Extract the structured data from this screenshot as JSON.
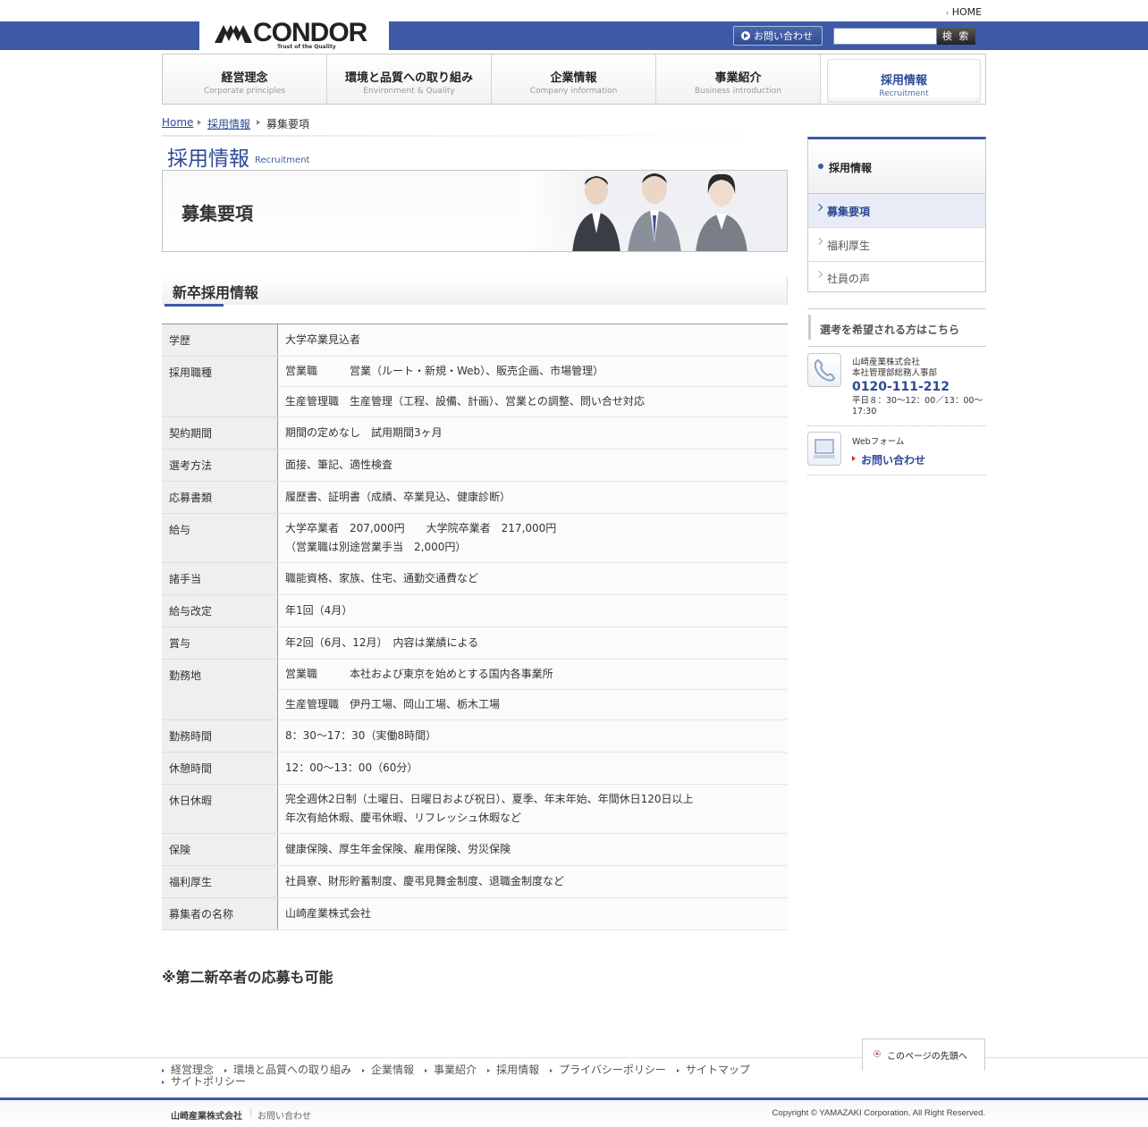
{
  "header": {
    "home_link": "HOME",
    "logo_text": "CONDOR",
    "logo_tagline": "Trust of the Quality",
    "contact_button": "お問い合わせ",
    "search_placeholder": "",
    "search_button": "検 索",
    "brand_color": "#3d5aa6"
  },
  "nav": {
    "items": [
      {
        "jp": "経営理念",
        "en": "Corporate principles"
      },
      {
        "jp": "環境と品質への取り組み",
        "en": "Environment & Quality"
      },
      {
        "jp": "企業情報",
        "en": "Company information"
      },
      {
        "jp": "事業紹介",
        "en": "Business introduction"
      },
      {
        "jp": "採用情報",
        "en": "Recruitment"
      }
    ],
    "active_index": 4
  },
  "breadcrumb": [
    "Home",
    "採用情報",
    "募集要項"
  ],
  "page": {
    "title": "採用情報",
    "title_en": "Recruitment",
    "banner_title": "募集要項",
    "section_title": "新卒採用情報",
    "note": "※第二新卒者の応募も可能"
  },
  "table": [
    {
      "label": "学歴",
      "lines": [
        "大学卒業見込者"
      ]
    },
    {
      "label": "採用職種",
      "lines": [
        "営業職　　　営業（ルート・新規・Web）、販売企画、市場管理）",
        "生産管理職　生産管理（工程、設備、計画）、営業との調整、問い合せ対応"
      ]
    },
    {
      "label": "契約期間",
      "lines": [
        "期間の定めなし　試用期間3ヶ月"
      ]
    },
    {
      "label": "選考方法",
      "lines": [
        "面接、筆記、適性検査"
      ]
    },
    {
      "label": "応募書類",
      "lines": [
        "履歴書、証明書（成績、卒業見込、健康診断）"
      ]
    },
    {
      "label": "給与",
      "lines": [
        "大学卒業者　207,000円　　大学院卒業者　217,000円",
        "（営業職は別途営業手当　2,000円）"
      ]
    },
    {
      "label": "諸手当",
      "lines": [
        "職能資格、家族、住宅、通勤交通費など"
      ]
    },
    {
      "label": "給与改定",
      "lines": [
        "年1回（4月）"
      ]
    },
    {
      "label": "賞与",
      "lines": [
        "年2回（6月、12月）　内容は業績による"
      ]
    },
    {
      "label": "勤務地",
      "lines": [
        "営業職　　　本社および東京を始めとする国内各事業所",
        "生産管理職　伊丹工場、岡山工場、栃木工場"
      ]
    },
    {
      "label": "勤務時間",
      "lines": [
        "8：30～17：30（実働8時間）"
      ]
    },
    {
      "label": "休憩時間",
      "lines": [
        "12：00～13：00（60分）"
      ]
    },
    {
      "label": "休日休暇",
      "lines": [
        "完全週休2日制（土曜日、日曜日および祝日）、夏季、年末年始、年間休日120日以上",
        "年次有給休暇、慶弔休暇、リフレッシュ休暇など"
      ]
    },
    {
      "label": "保険",
      "lines": [
        "健康保険、厚生年金保険、雇用保険、労災保険"
      ]
    },
    {
      "label": "福利厚生",
      "lines": [
        "社員寮、財形貯蓄制度、慶弔見舞金制度、退職金制度など"
      ]
    },
    {
      "label": "募集者の名称",
      "lines": [
        "山崎産業株式会社"
      ]
    }
  ],
  "sidebar": {
    "heading": "採用情報",
    "items": [
      "募集要項",
      "福利厚生",
      "社員の声"
    ],
    "active_index": 0,
    "apply_heading": "選考を希望される方はこちら",
    "phone_company": "山崎産業株式会社",
    "phone_dept": "本社管理部総務人事部",
    "phone_number": "0120-111-212",
    "phone_hours": "平日８：30～12：00／13：00～17:30",
    "web_label": "Webフォーム",
    "web_link": "お問い合わせ"
  },
  "footer": {
    "page_top": "このページの先頭へ",
    "links": [
      "経営理念",
      "環境と品質への取り組み",
      "企業情報",
      "事業紹介",
      "採用情報",
      "プライバシーポリシー",
      "サイトマップ",
      "サイトポリシー"
    ],
    "company": "山崎産業株式会社",
    "contact": "お問い合わせ",
    "copyright": "Copyright © YAMAZAKI Corporation. All Right Reserved."
  }
}
